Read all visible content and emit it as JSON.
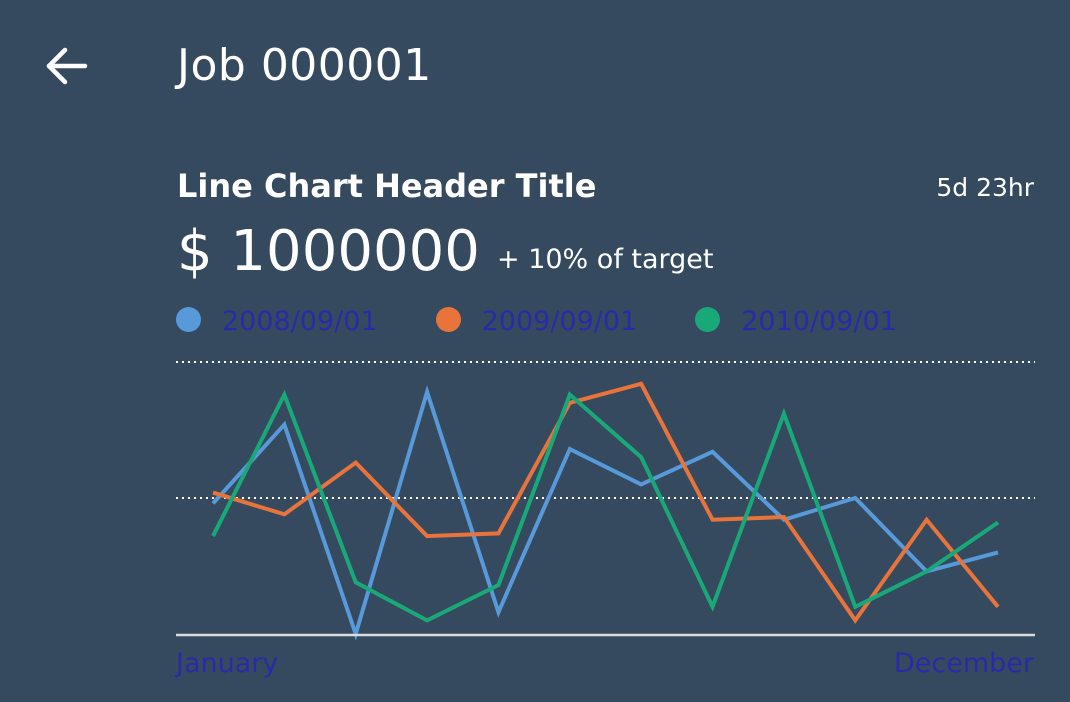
{
  "header": {
    "back_icon": "arrow-left-icon",
    "title": "Job 000001"
  },
  "card": {
    "title": "Line Chart Header Title",
    "time": "5d 23hr",
    "kpi_value": "$ 1000000",
    "kpi_delta": "+ 10% of target"
  },
  "chart_data": {
    "type": "line",
    "x": [
      1,
      2,
      3,
      4,
      5,
      6,
      7,
      8,
      9,
      10,
      11,
      12
    ],
    "x_tick_labels": [
      "January",
      "December"
    ],
    "ylim": [
      0,
      100
    ],
    "gridlines": [
      50,
      100
    ],
    "grid": true,
    "legend_position": "top-left",
    "series": [
      {
        "name": "2008/09/01",
        "color": "#5899da",
        "values": [
          48,
          77,
          0,
          89,
          8,
          68,
          55,
          67,
          42,
          50,
          23,
          30
        ]
      },
      {
        "name": "2009/09/01",
        "color": "#e8743b",
        "values": [
          52,
          44,
          63,
          36,
          37,
          85,
          92,
          42,
          43,
          5,
          42,
          10
        ]
      },
      {
        "name": "2010/09/01",
        "color": "#19a979",
        "values": [
          36,
          88,
          19,
          5,
          18,
          88,
          65,
          10,
          81,
          10,
          23,
          41
        ]
      }
    ]
  }
}
